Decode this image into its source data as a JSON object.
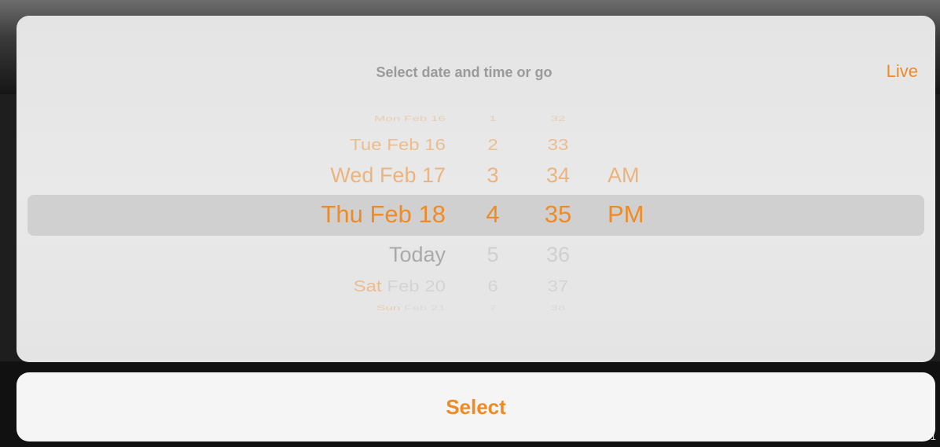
{
  "picker": {
    "title": "Select date and time or go",
    "live_label": "Live",
    "date_column": [
      {
        "pre": "Mon",
        "rest": " Feb 16"
      },
      {
        "pre": "Tue",
        "rest": " Feb 16"
      },
      {
        "pre": "Wed",
        "rest": " Feb 17"
      },
      {
        "pre": "Thu",
        "rest": " Feb 18"
      },
      {
        "pre": "",
        "rest": "Today"
      },
      {
        "pre": "Sat",
        "rest": " Feb 20"
      },
      {
        "pre": "Sun",
        "rest": " Feb 21"
      }
    ],
    "hour_column": [
      "1",
      "2",
      "3",
      "4",
      "5",
      "6",
      "7"
    ],
    "minute_column": [
      "32",
      "33",
      "34",
      "35",
      "36",
      "37",
      "38"
    ],
    "ampm_column": [
      "AM",
      "PM"
    ],
    "selected": {
      "date": "Thu Feb 18",
      "hour": "4",
      "minute": "35",
      "ampm": "PM"
    }
  },
  "action": {
    "select_label": "Select"
  },
  "colors": {
    "accent": "#f08a24",
    "sheet_bg": "#e7e7e7",
    "selection_band": "#d0d0d0"
  }
}
